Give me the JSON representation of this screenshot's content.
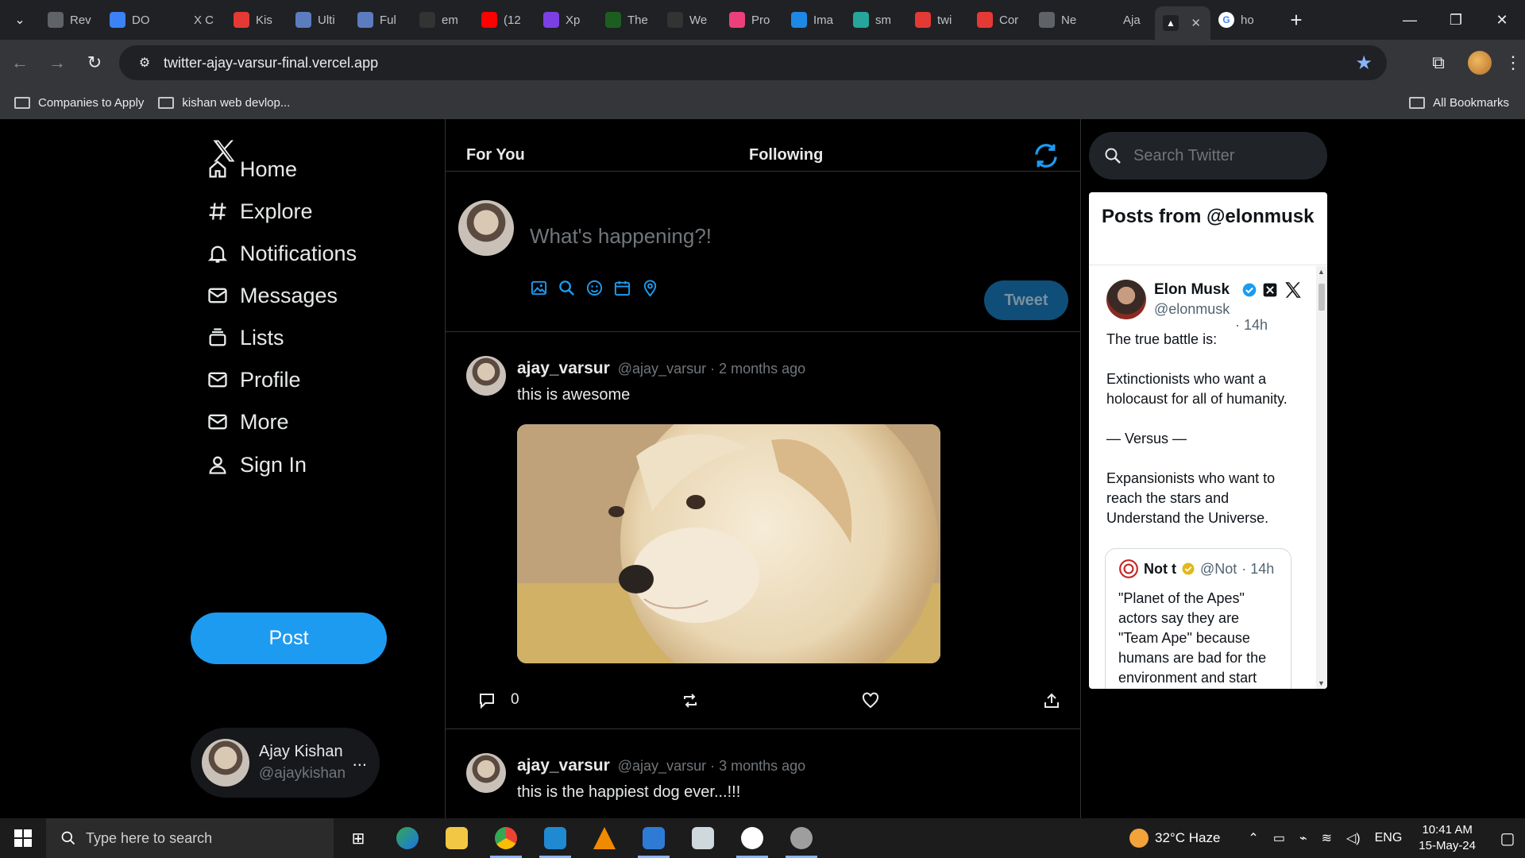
{
  "browser": {
    "tabs": [
      {
        "label": "Rev",
        "color": "#5f6368"
      },
      {
        "label": "DO",
        "color": "#3b82f6"
      },
      {
        "label": "X C",
        "color": "#202124"
      },
      {
        "label": "Kis",
        "color": "#e53935"
      },
      {
        "label": "Ulti",
        "color": "#5c7cbf"
      },
      {
        "label": "Ful",
        "color": "#5c7cbf"
      },
      {
        "label": "em",
        "color": "#333"
      },
      {
        "label": "(12",
        "color": "#ff0000"
      },
      {
        "label": "Xp",
        "color": "#7b3fe4"
      },
      {
        "label": "The",
        "color": "#1b5e20"
      },
      {
        "label": "We",
        "color": "#333"
      },
      {
        "label": "Pro",
        "color": "#ec407a"
      },
      {
        "label": "Ima",
        "color": "#1e88e5"
      },
      {
        "label": "sm",
        "color": "#26a69a"
      },
      {
        "label": "twi",
        "color": "#e53935"
      },
      {
        "label": "Cor",
        "color": "#e53935"
      },
      {
        "label": "Ne",
        "color": "#5f6368"
      },
      {
        "label": "Aja",
        "color": "#202124"
      }
    ],
    "active_tab_close": "✕",
    "extra_tab_label": "ho",
    "new_tab": "+",
    "url": "twitter-ajay-varsur-final.vercel.app",
    "bookmarks": [
      "Companies to Apply",
      "kishan web devlop..."
    ],
    "all_bookmarks": "All Bookmarks"
  },
  "sidebar": {
    "nav": [
      {
        "label": "Home",
        "icon": "home-icon"
      },
      {
        "label": "Explore",
        "icon": "hash-icon"
      },
      {
        "label": "Notifications",
        "icon": "bell-icon"
      },
      {
        "label": "Messages",
        "icon": "mail-icon"
      },
      {
        "label": "Lists",
        "icon": "list-icon"
      },
      {
        "label": "Profile",
        "icon": "mail-icon"
      },
      {
        "label": "More",
        "icon": "mail-icon"
      },
      {
        "label": "Sign In",
        "icon": "user-icon"
      }
    ],
    "post_label": "Post",
    "user": {
      "name": "Ajay Kishan",
      "handle": "@ajaykishan",
      "more": "..."
    }
  },
  "feed": {
    "tabs": [
      "For You",
      "Following"
    ],
    "composer": {
      "placeholder": "What's happening?!",
      "tweet_label": "Tweet"
    },
    "posts": [
      {
        "name": "ajay_varsur",
        "meta": "@ajay_varsur · 2 months ago",
        "text": "this is awesome",
        "reply_count": "0"
      },
      {
        "name": "ajay_varsur",
        "meta": "@ajay_varsur · 3 months ago",
        "text": "this is the happiest dog ever...!!!"
      }
    ]
  },
  "right": {
    "search_placeholder": "Search Twitter",
    "embed": {
      "title": "Posts from @elonmusk",
      "author_name": "Elon Musk",
      "author_handle": "@elonmusk",
      "time": "· 14h",
      "text": [
        "The true battle is:",
        "Extinctionists who want a holocaust for all of humanity.",
        "— Versus —",
        "Expansionists who want to reach the stars and Understand the Universe."
      ],
      "quote": {
        "name": "Not t",
        "handle": "@Not",
        "time": "· 14h",
        "text": "\"Planet of the Apes\" actors say they are \"Team Ape\" because humans are bad for the environment and start"
      }
    }
  },
  "taskbar": {
    "search_placeholder": "Type here to search",
    "weather": "32°C  Haze",
    "lang": "ENG",
    "time": "10:41 AM",
    "date": "15-May-24"
  }
}
